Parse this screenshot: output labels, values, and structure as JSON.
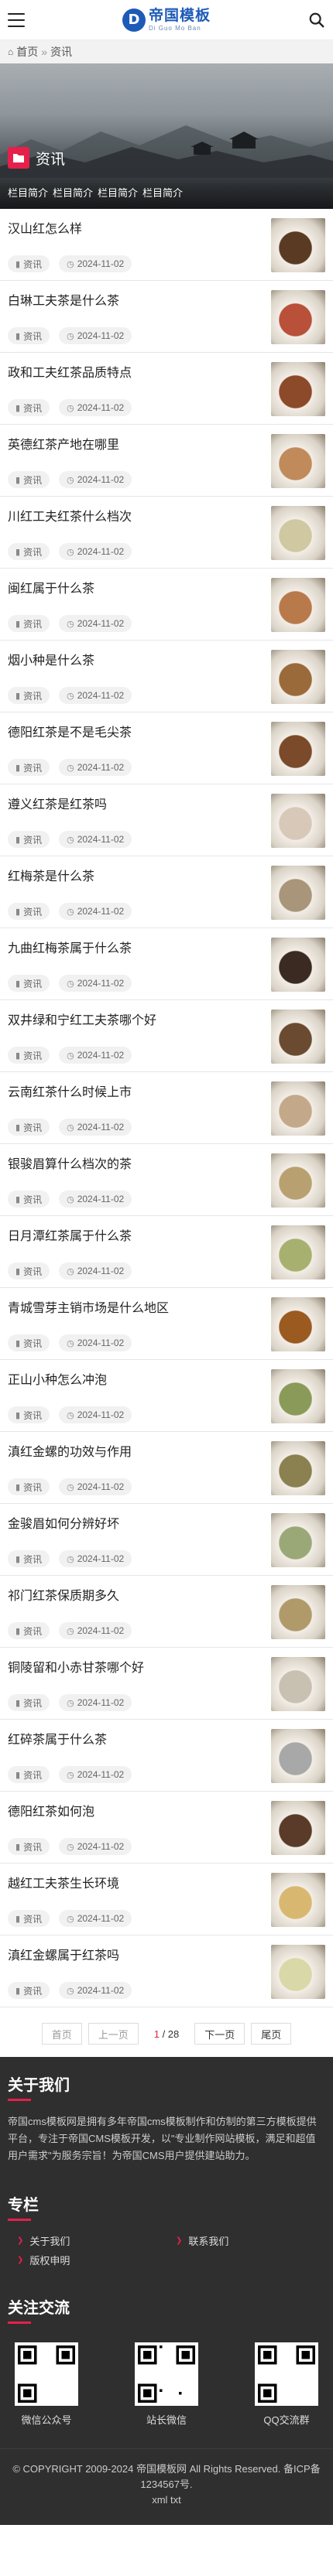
{
  "header": {
    "logo_cn": "帝国模板",
    "logo_en": "Di Guo Mo Ban"
  },
  "breadcrumb": {
    "home": "首页",
    "sep": "»",
    "current": "资讯"
  },
  "banner": {
    "title": "资讯",
    "subcats": [
      "栏目简介",
      "栏目简介",
      "栏目简介",
      "栏目简介"
    ]
  },
  "articles": [
    {
      "title": "汉山红怎么样",
      "tag": "资讯",
      "date": "2024-11-02",
      "thumb": "#5a3a22"
    },
    {
      "title": "白琳工夫茶是什么茶",
      "tag": "资讯",
      "date": "2024-11-02",
      "thumb": "#b9503a"
    },
    {
      "title": "政和工夫红茶品质特点",
      "tag": "资讯",
      "date": "2024-11-02",
      "thumb": "#8c4a2a"
    },
    {
      "title": "英德红茶产地在哪里",
      "tag": "资讯",
      "date": "2024-11-02",
      "thumb": "#c08a5a"
    },
    {
      "title": "川红工夫红茶什么档次",
      "tag": "资讯",
      "date": "2024-11-02",
      "thumb": "#cfc8a0"
    },
    {
      "title": "闽红属于什么茶",
      "tag": "资讯",
      "date": "2024-11-02",
      "thumb": "#b87a4a"
    },
    {
      "title": "烟小种是什么茶",
      "tag": "资讯",
      "date": "2024-11-02",
      "thumb": "#9a6a3a"
    },
    {
      "title": "德阳红茶是不是毛尖茶",
      "tag": "资讯",
      "date": "2024-11-02",
      "thumb": "#7a4a2a"
    },
    {
      "title": "遵义红茶是红茶吗",
      "tag": "资讯",
      "date": "2024-11-02",
      "thumb": "#d8c8b8"
    },
    {
      "title": "红梅茶是什么茶",
      "tag": "资讯",
      "date": "2024-11-02",
      "thumb": "#a8957a"
    },
    {
      "title": "九曲红梅茶属于什么茶",
      "tag": "资讯",
      "date": "2024-11-02",
      "thumb": "#3a2a22"
    },
    {
      "title": "双井绿和宁红工夫茶哪个好",
      "tag": "资讯",
      "date": "2024-11-02",
      "thumb": "#6a4a30"
    },
    {
      "title": "云南红茶什么时候上市",
      "tag": "资讯",
      "date": "2024-11-02",
      "thumb": "#c4a88a"
    },
    {
      "title": "银骏眉算什么档次的茶",
      "tag": "资讯",
      "date": "2024-11-02",
      "thumb": "#b8a070"
    },
    {
      "title": "日月潭红茶属于什么茶",
      "tag": "资讯",
      "date": "2024-11-02",
      "thumb": "#a8b070"
    },
    {
      "title": "青城雪芽主销市场是什么地区",
      "tag": "资讯",
      "date": "2024-11-02",
      "thumb": "#9a5a20"
    },
    {
      "title": "正山小种怎么冲泡",
      "tag": "资讯",
      "date": "2024-11-02",
      "thumb": "#8a9a58"
    },
    {
      "title": "滇红金螺的功效与作用",
      "tag": "资讯",
      "date": "2024-11-02",
      "thumb": "#8a8050"
    },
    {
      "title": "金骏眉如何分辨好坏",
      "tag": "资讯",
      "date": "2024-11-02",
      "thumb": "#9aa878"
    },
    {
      "title": "祁门红茶保质期多久",
      "tag": "资讯",
      "date": "2024-11-02",
      "thumb": "#b09a6a"
    },
    {
      "title": "铜陵留和小赤甘茶哪个好",
      "tag": "资讯",
      "date": "2024-11-02",
      "thumb": "#c8c0b0"
    },
    {
      "title": "红碎茶属于什么茶",
      "tag": "资讯",
      "date": "2024-11-02",
      "thumb": "#a8a8a8"
    },
    {
      "title": "德阳红茶如何泡",
      "tag": "资讯",
      "date": "2024-11-02",
      "thumb": "#5a3a28"
    },
    {
      "title": "越红工夫茶生长环境",
      "tag": "资讯",
      "date": "2024-11-02",
      "thumb": "#d8b870"
    },
    {
      "title": "滇红金螺属于红茶吗",
      "tag": "资讯",
      "date": "2024-11-02",
      "thumb": "#d8d8a8"
    }
  ],
  "pagination": {
    "first": "首页",
    "prev": "上一页",
    "current": "1",
    "total": "/ 28",
    "next": "下一页",
    "last": "尾页"
  },
  "footer": {
    "about_title": "关于我们",
    "about_text": "帝国cms模板网是拥有多年帝国cms模板制作和仿制的第三方模板提供平台，专注于帝国CMS模板开发，以\"专业制作网站模板，满足和超值用户需求\"为服务宗旨！为帝国CMS用户提供建站助力。",
    "col_title": "专栏",
    "links": [
      "关于我们",
      "联系我们",
      "版权申明"
    ],
    "follow_title": "关注交流",
    "qr": [
      "微信公众号",
      "站长微信",
      "QQ交流群"
    ],
    "copyright": "© COPYRIGHT 2009-2024 帝国模板网 All Rights Reserved. 备ICP备1234567号.",
    "xml": "xml",
    "txt": "txt"
  }
}
